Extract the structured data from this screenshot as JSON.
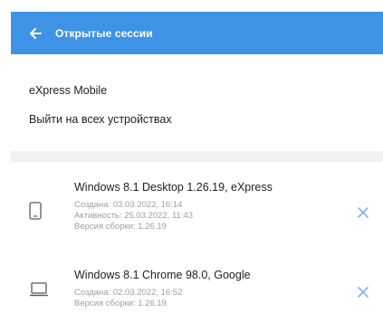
{
  "header": {
    "title": "Открытые сессии",
    "back_icon": "arrow-left-icon",
    "color": "#3f93e6"
  },
  "app_name": "eXpress Mobile",
  "logout_all_label": "Выйти на всех устройствах",
  "sessions": [
    {
      "name": "Windows 8.1 Desktop 1.26.19, eXpress",
      "created": "Создана: 03.03.2022, 16:14",
      "activity": "Активность: 25.03.2022, 11:43",
      "build": "Версия сборки: 1.26.19",
      "device_icon": "phone-icon",
      "close_icon": "close-icon"
    },
    {
      "name": "Windows 8.1 Chrome 98.0, Google",
      "created": "Создана: 02.03.2022, 16:52",
      "build": "Версия сборки: 1.26.19",
      "device_icon": "laptop-icon",
      "close_icon": "close-icon"
    }
  ],
  "colors": {
    "accent": "#3f93e6",
    "close_icon": "#7fb3ea",
    "muted_text": "#9a9ea6",
    "section_gap": "#f1f2f4"
  }
}
